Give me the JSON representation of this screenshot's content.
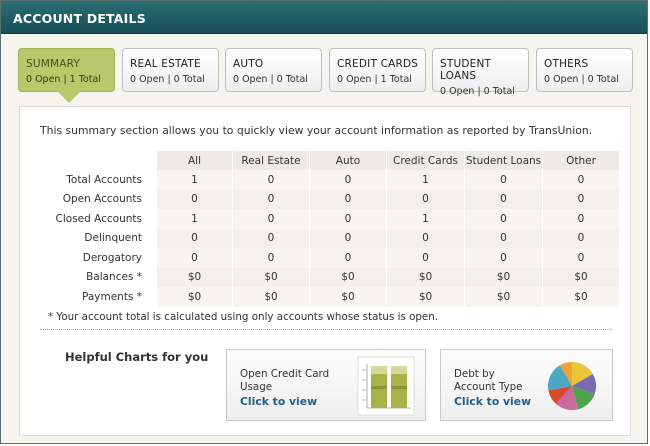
{
  "title": "ACCOUNT DETAILS",
  "tabs": [
    {
      "name": "SUMMARY",
      "count": "0 Open | 1 Total",
      "active": true
    },
    {
      "name": "REAL ESTATE",
      "count": "0 Open | 0 Total"
    },
    {
      "name": "AUTO",
      "count": "0 Open | 0 Total"
    },
    {
      "name": "CREDIT CARDS",
      "count": "0 Open | 1 Total"
    },
    {
      "name": "STUDENT LOANS",
      "count": "0 Open | 0 Total"
    },
    {
      "name": "OTHERS",
      "count": "0 Open | 0 Total"
    }
  ],
  "intro": "This summary section allows you to quickly view your account information as reported by TransUnion.",
  "table": {
    "columns": [
      "All",
      "Real Estate",
      "Auto",
      "Credit Cards",
      "Student Loans",
      "Other"
    ],
    "rows": [
      {
        "label": "Total Accounts",
        "values": [
          "1",
          "0",
          "0",
          "1",
          "0",
          "0"
        ]
      },
      {
        "label": "Open Accounts",
        "values": [
          "0",
          "0",
          "0",
          "0",
          "0",
          "0"
        ]
      },
      {
        "label": "Closed Accounts",
        "values": [
          "1",
          "0",
          "0",
          "1",
          "0",
          "0"
        ]
      },
      {
        "label": "Delinquent",
        "values": [
          "0",
          "0",
          "0",
          "0",
          "0",
          "0"
        ]
      },
      {
        "label": "Derogatory",
        "values": [
          "0",
          "0",
          "0",
          "0",
          "0",
          "0"
        ]
      },
      {
        "label": "Balances  *",
        "values": [
          "$0",
          "$0",
          "$0",
          "$0",
          "$0",
          "$0"
        ]
      },
      {
        "label": "Payments  *",
        "values": [
          "$0",
          "$0",
          "$0",
          "$0",
          "$0",
          "$0"
        ]
      }
    ]
  },
  "footnote": "* Your account total is calculated using only accounts whose status is open.",
  "helpful": "Helpful Charts for you",
  "cards": [
    {
      "title": "Open Credit Card Usage",
      "link": "Click to view",
      "icon": "bar-chart-thumbnail"
    },
    {
      "title": "Debt by Account Type",
      "link": "Click to view",
      "icon": "pie-chart-thumbnail"
    }
  ],
  "colors": {
    "header": "#1f5f65",
    "active_tab": "#b8c86b",
    "link": "#1d5f86"
  }
}
